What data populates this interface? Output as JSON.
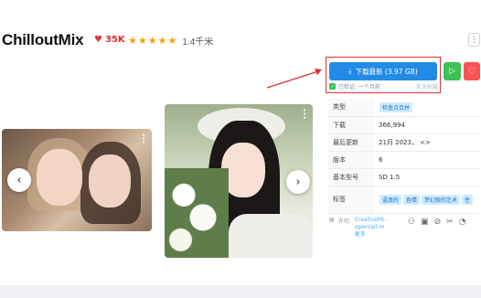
{
  "model": {
    "title": "ChilloutMix",
    "likes": "35K",
    "stars": 5,
    "rating_count": "1.4千米"
  },
  "actions": {
    "download_label": "下载最新 (3.97 GB)",
    "verified_label": "已检证: 一个月前",
    "safety_label": "安全权威"
  },
  "details": {
    "rows": [
      {
        "key": "类型",
        "value": "",
        "badges": [
          "检查点合并"
        ]
      },
      {
        "key": "下载",
        "value": "366,994",
        "badges": []
      },
      {
        "key": "最后更新",
        "value": "21月 2023，  <>",
        "badges": []
      },
      {
        "key": "版本",
        "value": "6",
        "badges": []
      },
      {
        "key": "基本型号",
        "value": "SD 1.5",
        "badges": []
      },
      {
        "key": "标签",
        "value": "",
        "badges": [
          "逼真的",
          "色情",
          "梦幻般的艺术",
          "性"
        ]
      }
    ]
  },
  "license": {
    "label": "许可:",
    "text": "CreativeML - openrail-m 更多"
  },
  "icons": {
    "like": "heart-icon",
    "star": "star-icon",
    "more": "more-vertical-icon",
    "download": "download-icon",
    "play": "play-icon",
    "prev": "chevron-left-icon",
    "next": "chevron-right-icon"
  },
  "colors": {
    "primary": "#228be6",
    "success": "#40c057",
    "danger": "#fa5252",
    "highlight": "#e03131",
    "star": "#f59f00"
  }
}
